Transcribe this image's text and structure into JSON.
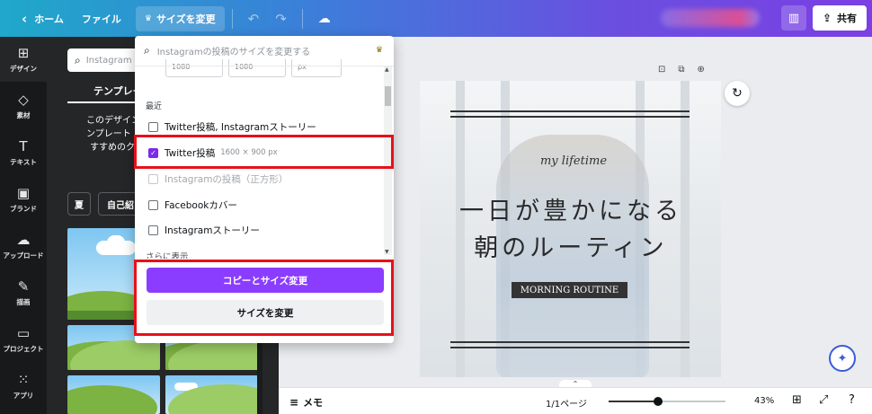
{
  "topbar": {
    "home": "ホーム",
    "file": "ファイル",
    "resize": "サイズを変更",
    "share": "共有"
  },
  "sidebar": {
    "items": [
      {
        "label": "デザイン",
        "icon": "layout-icon"
      },
      {
        "label": "素材",
        "icon": "shapes-icon"
      },
      {
        "label": "テキスト",
        "icon": "text-icon"
      },
      {
        "label": "ブランド",
        "icon": "brand-icon"
      },
      {
        "label": "アップロード",
        "icon": "upload-icon"
      },
      {
        "label": "描画",
        "icon": "draw-icon"
      },
      {
        "label": "プロジェクト",
        "icon": "folder-icon"
      },
      {
        "label": "アプリ",
        "icon": "apps-icon"
      }
    ]
  },
  "panel": {
    "search_placeholder": "Instagram",
    "tab": "テンプレー",
    "desc_lines": [
      "このデザイン",
      "ンプレート",
      "すすめのク"
    ],
    "chips": [
      "夏",
      "自己紹"
    ]
  },
  "dropdown": {
    "search_placeholder": "Instagramの投稿のサイズを変更する",
    "dims": [
      "1080",
      "1080",
      "px"
    ],
    "recent_label": "最近",
    "options": [
      {
        "label": "Twitter投稿, Instagramストーリー",
        "checked": false,
        "disabled": false,
        "sub": ""
      },
      {
        "label": "Twitter投稿",
        "checked": true,
        "disabled": false,
        "sub": "1600 × 900 px"
      },
      {
        "label": "Instagramの投稿（正方形）",
        "checked": false,
        "disabled": true,
        "sub": ""
      },
      {
        "label": "Facebookカバー",
        "checked": false,
        "disabled": false,
        "sub": ""
      },
      {
        "label": "Instagramストーリー",
        "checked": false,
        "disabled": false,
        "sub": ""
      }
    ],
    "more": "さらに表示",
    "copy_resize": "コピーとサイズ変更",
    "resize": "サイズを変更"
  },
  "design": {
    "script": "my lifetime",
    "title_line1": "一日が豊かになる",
    "title_line2": "朝のルーティン",
    "tag": "MORNING ROUTINE"
  },
  "bottombar": {
    "memo": "メモ",
    "pages": "1/1ページ",
    "zoom": "43%",
    "zoom_level": 0.43
  },
  "colors": {
    "accent": "#8b3dff",
    "highlight": "#e8101a"
  }
}
